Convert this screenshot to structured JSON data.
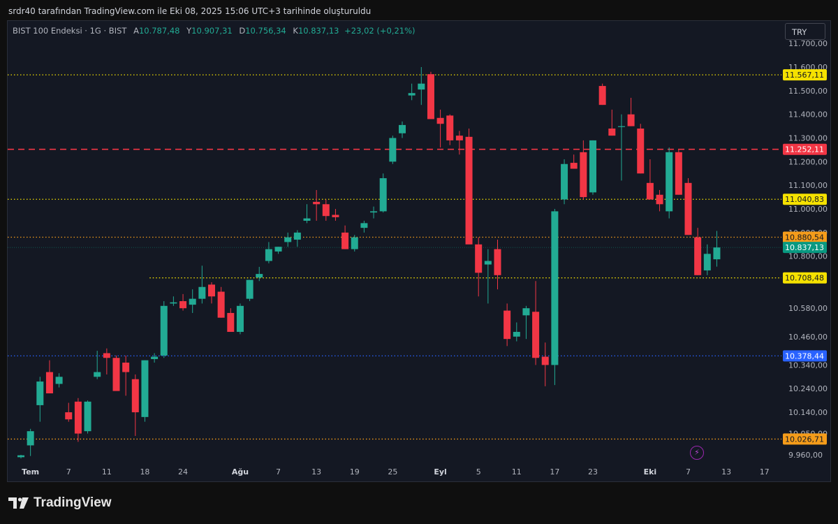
{
  "header": {
    "caption": "srdr40 tarafından TradingView.com ile Eki 08, 2025 15:06 UTC+3 tarihinde oluşturuldu"
  },
  "legend": {
    "symbol": "BIST 100 Endeksi · 1G · BIST",
    "open_label": "A",
    "open": "10.787,48",
    "high_label": "Y",
    "high": "10.907,31",
    "low_label": "D",
    "low": "10.756,34",
    "close_label": "K",
    "close": "10.837,13",
    "change": "+23,02 (+0,21%)"
  },
  "currency_button": "TRY",
  "brand": {
    "name": "TradingView"
  },
  "icons": {
    "logo": "tradingview-logo-icon",
    "flash": "lightning-icon"
  },
  "chart_data": {
    "type": "candlestick",
    "colors": {
      "up": "#22ab94",
      "down": "#f23645",
      "background": "#141823"
    },
    "y_ticks": [
      {
        "value": 11700,
        "label": "11.700,00"
      },
      {
        "value": 11600,
        "label": "11.600,00"
      },
      {
        "value": 11500,
        "label": "11.500,00"
      },
      {
        "value": 11400,
        "label": "11.400,00"
      },
      {
        "value": 11300,
        "label": "11.300,00"
      },
      {
        "value": 11200,
        "label": "11.200,00"
      },
      {
        "value": 11100,
        "label": "11.100,00"
      },
      {
        "value": 11000,
        "label": "11.000,00"
      },
      {
        "value": 10900,
        "label": "10.900,00"
      },
      {
        "value": 10800,
        "label": "10.800,00"
      },
      {
        "value": 10580,
        "label": "10.580,00"
      },
      {
        "value": 10460,
        "label": "10.460,00"
      },
      {
        "value": 10340,
        "label": "10.340,00"
      },
      {
        "value": 10240,
        "label": "10.240,00"
      },
      {
        "value": 10140,
        "label": "10.140,00"
      },
      {
        "value": 10050,
        "label": "10.050,00"
      },
      {
        "value": 9960,
        "label": "9.960,00"
      }
    ],
    "x_ticks": [
      {
        "index": 1,
        "label": "Tem",
        "bold": true
      },
      {
        "index": 5,
        "label": "7"
      },
      {
        "index": 9,
        "label": "11"
      },
      {
        "index": 13,
        "label": "18"
      },
      {
        "index": 17,
        "label": "24"
      },
      {
        "index": 23,
        "label": "Ağu",
        "bold": true
      },
      {
        "index": 27,
        "label": "7"
      },
      {
        "index": 31,
        "label": "13"
      },
      {
        "index": 35,
        "label": "19"
      },
      {
        "index": 39,
        "label": "25"
      },
      {
        "index": 44,
        "label": "Eyl",
        "bold": true
      },
      {
        "index": 48,
        "label": "5"
      },
      {
        "index": 52,
        "label": "11"
      },
      {
        "index": 56,
        "label": "17"
      },
      {
        "index": 60,
        "label": "23"
      },
      {
        "index": 66,
        "label": "Eki",
        "bold": true
      },
      {
        "index": 70,
        "label": "7"
      },
      {
        "index": 74,
        "label": "13"
      },
      {
        "index": 78,
        "label": "17"
      }
    ],
    "levels": [
      {
        "value": 11567.11,
        "label": "11.567,11",
        "color": "#f5e100",
        "text": "#131722",
        "style": "dotted",
        "from_index": -1
      },
      {
        "value": 11252.11,
        "label": "11.252,11",
        "color": "#f23645",
        "text": "#ffffff",
        "style": "dashed",
        "from_index": -1
      },
      {
        "value": 11040.83,
        "label": "11.040,83",
        "color": "#f5e100",
        "text": "#131722",
        "style": "dotted",
        "from_index": -1
      },
      {
        "value": 10880.54,
        "label": "10.880,54",
        "color": "#f59c1a",
        "text": "#131722",
        "style": "dotted",
        "from_index": -1
      },
      {
        "value": 10837.13,
        "label": "10.837,13",
        "color": "#089981",
        "text": "#ffffff",
        "style": "faint",
        "from_index": -1
      },
      {
        "value": 10708.48,
        "label": "10.708,48",
        "color": "#f5e100",
        "text": "#131722",
        "style": "dotted",
        "from_index": 13.5
      },
      {
        "value": 10378.44,
        "label": "10.378,44",
        "color": "#2962ff",
        "text": "#ffffff",
        "style": "dotted",
        "from_index": -1
      },
      {
        "value": 10026.71,
        "label": "10.026,71",
        "color": "#f59c1a",
        "text": "#131722",
        "style": "dotted",
        "from_index": -1
      }
    ],
    "candles": [
      {
        "i": 0,
        "o": 9950,
        "h": 9960,
        "l": 9945,
        "c": 9958
      },
      {
        "i": 1,
        "o": 10000,
        "h": 10070,
        "l": 9955,
        "c": 10060
      },
      {
        "i": 2,
        "o": 10170,
        "h": 10290,
        "l": 10100,
        "c": 10270
      },
      {
        "i": 3,
        "o": 10310,
        "h": 10360,
        "l": 10220,
        "c": 10220
      },
      {
        "i": 4,
        "o": 10260,
        "h": 10305,
        "l": 10245,
        "c": 10290
      },
      {
        "i": 5,
        "o": 10140,
        "h": 10180,
        "l": 10100,
        "c": 10110
      },
      {
        "i": 6,
        "o": 10185,
        "h": 10200,
        "l": 10015,
        "c": 10050
      },
      {
        "i": 7,
        "o": 10060,
        "h": 10190,
        "l": 10050,
        "c": 10185
      },
      {
        "i": 8,
        "o": 10290,
        "h": 10400,
        "l": 10280,
        "c": 10310
      },
      {
        "i": 9,
        "o": 10390,
        "h": 10410,
        "l": 10300,
        "c": 10370
      },
      {
        "i": 10,
        "o": 10370,
        "h": 10380,
        "l": 10250,
        "c": 10230
      },
      {
        "i": 11,
        "o": 10350,
        "h": 10380,
        "l": 10210,
        "c": 10310
      },
      {
        "i": 12,
        "o": 10280,
        "h": 10300,
        "l": 10040,
        "c": 10140
      },
      {
        "i": 13,
        "o": 10120,
        "h": 10360,
        "l": 10100,
        "c": 10360
      },
      {
        "i": 14,
        "o": 10365,
        "h": 10390,
        "l": 10350,
        "c": 10375
      },
      {
        "i": 15,
        "o": 10380,
        "h": 10610,
        "l": 10370,
        "c": 10590
      },
      {
        "i": 16,
        "o": 10600,
        "h": 10630,
        "l": 10590,
        "c": 10605
      },
      {
        "i": 17,
        "o": 10610,
        "h": 10640,
        "l": 10570,
        "c": 10580
      },
      {
        "i": 18,
        "o": 10595,
        "h": 10660,
        "l": 10560,
        "c": 10620
      },
      {
        "i": 19,
        "o": 10620,
        "h": 10760,
        "l": 10600,
        "c": 10670
      },
      {
        "i": 20,
        "o": 10680,
        "h": 10690,
        "l": 10600,
        "c": 10630
      },
      {
        "i": 21,
        "o": 10650,
        "h": 10670,
        "l": 10540,
        "c": 10540
      },
      {
        "i": 22,
        "o": 10560,
        "h": 10580,
        "l": 10480,
        "c": 10480
      },
      {
        "i": 23,
        "o": 10480,
        "h": 10600,
        "l": 10470,
        "c": 10590
      },
      {
        "i": 24,
        "o": 10620,
        "h": 10700,
        "l": 10610,
        "c": 10700
      },
      {
        "i": 25,
        "o": 10710,
        "h": 10755,
        "l": 10695,
        "c": 10725
      },
      {
        "i": 26,
        "o": 10780,
        "h": 10860,
        "l": 10770,
        "c": 10830
      },
      {
        "i": 27,
        "o": 10820,
        "h": 10840,
        "l": 10810,
        "c": 10840
      },
      {
        "i": 28,
        "o": 10860,
        "h": 10900,
        "l": 10840,
        "c": 10880
      },
      {
        "i": 29,
        "o": 10870,
        "h": 10910,
        "l": 10840,
        "c": 10900
      },
      {
        "i": 30,
        "o": 10950,
        "h": 11020,
        "l": 10940,
        "c": 10960
      },
      {
        "i": 31,
        "o": 11030,
        "h": 11080,
        "l": 10950,
        "c": 11020
      },
      {
        "i": 32,
        "o": 11020,
        "h": 11040,
        "l": 10950,
        "c": 10970
      },
      {
        "i": 33,
        "o": 10975,
        "h": 11000,
        "l": 10950,
        "c": 10965
      },
      {
        "i": 34,
        "o": 10900,
        "h": 10930,
        "l": 10830,
        "c": 10830
      },
      {
        "i": 35,
        "o": 10830,
        "h": 10890,
        "l": 10820,
        "c": 10880
      },
      {
        "i": 36,
        "o": 10920,
        "h": 10950,
        "l": 10900,
        "c": 10940
      },
      {
        "i": 37,
        "o": 10985,
        "h": 11010,
        "l": 10960,
        "c": 10990
      },
      {
        "i": 38,
        "o": 10990,
        "h": 11150,
        "l": 10985,
        "c": 11130
      },
      {
        "i": 39,
        "o": 11200,
        "h": 11310,
        "l": 11190,
        "c": 11300
      },
      {
        "i": 40,
        "o": 11320,
        "h": 11370,
        "l": 11300,
        "c": 11355
      },
      {
        "i": 41,
        "o": 11480,
        "h": 11530,
        "l": 11460,
        "c": 11490
      },
      {
        "i": 42,
        "o": 11505,
        "h": 11600,
        "l": 11440,
        "c": 11530
      },
      {
        "i": 43,
        "o": 11570,
        "h": 11580,
        "l": 11380,
        "c": 11380
      },
      {
        "i": 44,
        "o": 11385,
        "h": 11420,
        "l": 11260,
        "c": 11360
      },
      {
        "i": 45,
        "o": 11395,
        "h": 11400,
        "l": 11270,
        "c": 11290
      },
      {
        "i": 46,
        "o": 11310,
        "h": 11330,
        "l": 11230,
        "c": 11290
      },
      {
        "i": 47,
        "o": 11305,
        "h": 11340,
        "l": 11230,
        "c": 10850
      },
      {
        "i": 48,
        "o": 10850,
        "h": 10880,
        "l": 10630,
        "c": 10730
      },
      {
        "i": 49,
        "o": 10765,
        "h": 10830,
        "l": 10600,
        "c": 10780
      },
      {
        "i": 50,
        "o": 10830,
        "h": 10870,
        "l": 10660,
        "c": 10720
      },
      {
        "i": 51,
        "o": 10570,
        "h": 10600,
        "l": 10420,
        "c": 10450
      },
      {
        "i": 52,
        "o": 10460,
        "h": 10520,
        "l": 10440,
        "c": 10480
      },
      {
        "i": 53,
        "o": 10550,
        "h": 10590,
        "l": 10450,
        "c": 10580
      },
      {
        "i": 54,
        "o": 10565,
        "h": 10695,
        "l": 10340,
        "c": 10370
      },
      {
        "i": 55,
        "o": 10375,
        "h": 10435,
        "l": 10250,
        "c": 10340
      },
      {
        "i": 56,
        "o": 10340,
        "h": 11000,
        "l": 10255,
        "c": 10990
      },
      {
        "i": 57,
        "o": 11040,
        "h": 11210,
        "l": 11020,
        "c": 11190
      },
      {
        "i": 58,
        "o": 11195,
        "h": 11230,
        "l": 11170,
        "c": 11170
      },
      {
        "i": 59,
        "o": 11240,
        "h": 11290,
        "l": 11040,
        "c": 11050
      },
      {
        "i": 60,
        "o": 11070,
        "h": 11290,
        "l": 11060,
        "c": 11290
      },
      {
        "i": 61,
        "o": 11520,
        "h": 11530,
        "l": 11440,
        "c": 11440
      },
      {
        "i": 62,
        "o": 11340,
        "h": 11420,
        "l": 11310,
        "c": 11310
      },
      {
        "i": 63,
        "o": 11350,
        "h": 11400,
        "l": 11120,
        "c": 11350
      },
      {
        "i": 64,
        "o": 11400,
        "h": 11470,
        "l": 11350,
        "c": 11350
      },
      {
        "i": 65,
        "o": 11340,
        "h": 11360,
        "l": 11150,
        "c": 11150
      },
      {
        "i": 66,
        "o": 11110,
        "h": 11210,
        "l": 11040,
        "c": 11040
      },
      {
        "i": 67,
        "o": 11060,
        "h": 11080,
        "l": 10990,
        "c": 11020
      },
      {
        "i": 68,
        "o": 10990,
        "h": 11260,
        "l": 10960,
        "c": 11240
      },
      {
        "i": 69,
        "o": 11240,
        "h": 11250,
        "l": 11060,
        "c": 11060
      },
      {
        "i": 70,
        "o": 11110,
        "h": 11130,
        "l": 10890,
        "c": 10890
      },
      {
        "i": 71,
        "o": 10880,
        "h": 10920,
        "l": 10720,
        "c": 10720
      },
      {
        "i": 72,
        "o": 10740,
        "h": 10850,
        "l": 10720,
        "c": 10810
      },
      {
        "i": 73,
        "o": 10787,
        "h": 10907,
        "l": 10756,
        "c": 10837
      }
    ]
  }
}
